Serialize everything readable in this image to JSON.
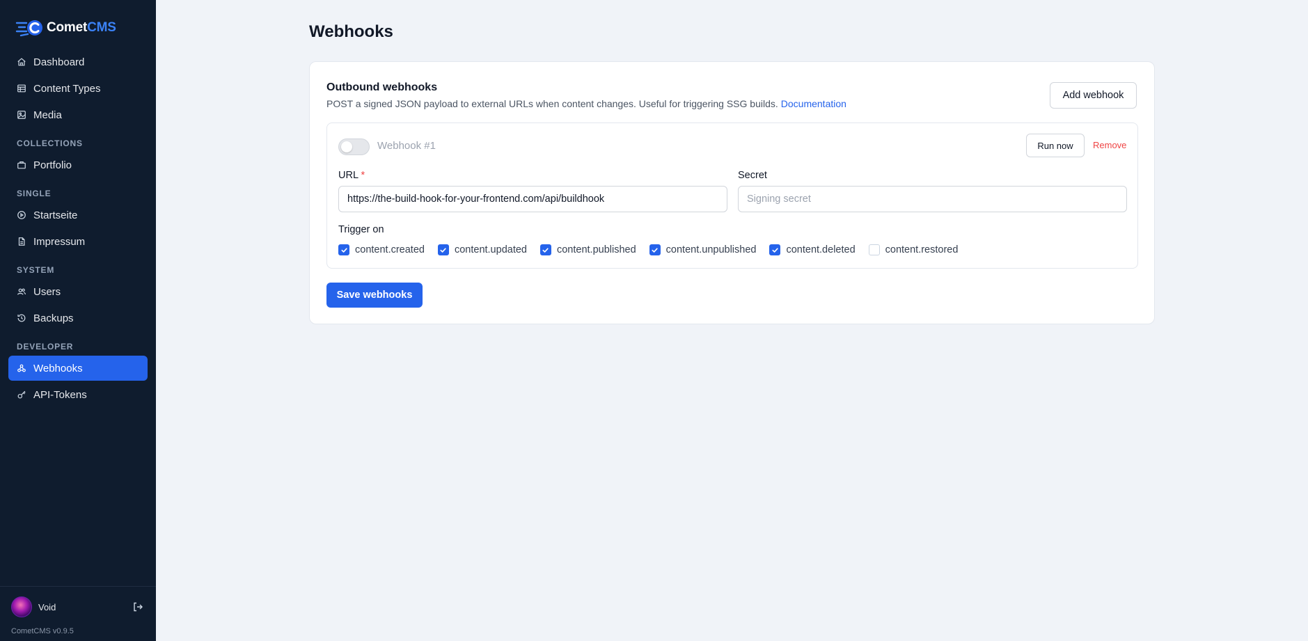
{
  "app": {
    "brand_prefix": "Comet",
    "brand_suffix": "CMS",
    "version": "CometCMS v0.9.5"
  },
  "sidebar": {
    "items_top": [
      {
        "label": "Dashboard",
        "icon": "home-icon"
      },
      {
        "label": "Content Types",
        "icon": "table-icon"
      },
      {
        "label": "Media",
        "icon": "images-icon"
      }
    ],
    "section_collections": "COLLECTIONS",
    "collections": [
      {
        "label": "Portfolio",
        "icon": "briefcase-icon"
      }
    ],
    "section_single": "SINGLE",
    "single": [
      {
        "label": "Startseite",
        "icon": "circle-play-icon"
      },
      {
        "label": "Impressum",
        "icon": "file-icon"
      }
    ],
    "section_system": "SYSTEM",
    "system": [
      {
        "label": "Users",
        "icon": "users-icon"
      },
      {
        "label": "Backups",
        "icon": "history-icon"
      }
    ],
    "section_developer": "DEVELOPER",
    "developer": [
      {
        "label": "Webhooks",
        "icon": "webhook-icon",
        "active": true
      },
      {
        "label": "API-Tokens",
        "icon": "key-icon"
      }
    ],
    "user": {
      "name": "Void"
    }
  },
  "page": {
    "title": "Webhooks"
  },
  "card": {
    "title": "Outbound webhooks",
    "description": "POST a signed JSON payload to external URLs when content changes. Useful for triggering SSG builds.",
    "doc_link": "Documentation",
    "add_button": "Add webhook"
  },
  "webhook": {
    "name": "Webhook #1",
    "enabled": false,
    "run_button": "Run now",
    "remove_link": "Remove",
    "url_label": "URL",
    "required_mark": "*",
    "url_value": "https://the-build-hook-for-your-frontend.com/api/buildhook",
    "secret_label": "Secret",
    "secret_placeholder": "Signing secret",
    "trigger_label": "Trigger on",
    "events": [
      {
        "label": "content.created",
        "checked": true
      },
      {
        "label": "content.updated",
        "checked": true
      },
      {
        "label": "content.published",
        "checked": true
      },
      {
        "label": "content.unpublished",
        "checked": true
      },
      {
        "label": "content.deleted",
        "checked": true
      },
      {
        "label": "content.restored",
        "checked": false
      }
    ]
  },
  "save_button": "Save webhooks",
  "colors": {
    "sidebar_bg": "#0f1c2e",
    "accent": "#2563eb",
    "danger": "#ef4444",
    "page_bg": "#f0f3f8"
  }
}
